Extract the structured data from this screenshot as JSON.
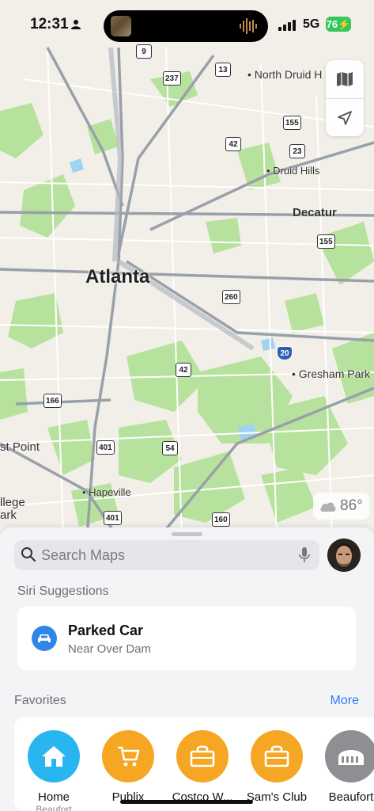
{
  "status_bar": {
    "time": "12:31",
    "network": "5G",
    "battery": "76"
  },
  "map": {
    "city_label": "Atlanta",
    "places": [
      {
        "name": "North Druid H",
        "dot": true
      },
      {
        "name": "Druid Hills",
        "dot": true
      },
      {
        "name": "Decatur",
        "dot": false
      },
      {
        "name": "Gresham Park",
        "dot": true
      },
      {
        "name": "Hapeville",
        "dot": true
      },
      {
        "name": "st Point",
        "dot": false
      },
      {
        "name": "llege",
        "dot": false
      },
      {
        "name": "ark",
        "dot": false
      }
    ],
    "route_shields": [
      "9",
      "237",
      "13",
      "155",
      "42",
      "23",
      "155",
      "260",
      "20",
      "42",
      "166",
      "401",
      "54",
      "401",
      "160"
    ]
  },
  "weather": {
    "temp": "86°",
    "icon": "cloud-icon"
  },
  "search": {
    "placeholder": "Search Maps"
  },
  "siri_suggestions": {
    "title": "Siri Suggestions",
    "item": {
      "title": "Parked Car",
      "subtitle": "Near Over Dam",
      "icon": "car-icon",
      "color": "#2f86e6"
    }
  },
  "favorites": {
    "title": "Favorites",
    "more_label": "More",
    "items": [
      {
        "label": "Home",
        "subtitle": "Beaufort",
        "icon": "house-icon",
        "color": "#29b6f0"
      },
      {
        "label": "Publix",
        "subtitle": "",
        "icon": "cart-icon",
        "color": "#f5a623"
      },
      {
        "label": "Costco W...",
        "subtitle": "",
        "icon": "bag-icon",
        "color": "#f5a623"
      },
      {
        "label": "Sam's Club",
        "subtitle": "",
        "icon": "bag-icon",
        "color": "#f5a623"
      },
      {
        "label": "Beaufort",
        "subtitle": "",
        "icon": "stadium-icon",
        "color": "#8e8e93"
      }
    ]
  },
  "colors": {
    "accent": "#2f7cf6",
    "park_green": "#a9dc8e",
    "battery_green": "#35c759"
  }
}
